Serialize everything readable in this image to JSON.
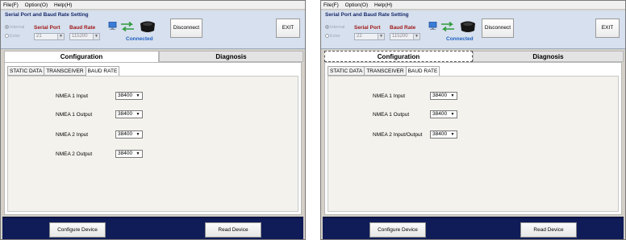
{
  "windows": [
    {
      "menu": [
        "File(F)",
        "Option(O)",
        "Help(H)"
      ],
      "port_title": "Serial Port and Baud Rate Setting",
      "radio_internal": "Internal",
      "radio_external": "Exter",
      "serial_port_label": "Serial Port",
      "baud_rate_label": "Baud Rate",
      "serial_port_value": "21",
      "baud_rate_value": "115200",
      "connected_text": "Connected",
      "disconnect_label": "Disconnect",
      "exit_label": "EXIT",
      "tab_configuration": "Configuration",
      "tab_diagnosis": "Diagnosis",
      "subtabs": [
        "STATIC DATA",
        "TRANSCEIVER",
        "BAUD RATE"
      ],
      "rows": [
        {
          "label": "NMEA 1 Input",
          "value": "38400"
        },
        {
          "label": "NMEA 1 Output",
          "value": "38400"
        },
        {
          "label": "NMEA 2 Input",
          "value": "38400"
        },
        {
          "label": "NMEA 2 Output",
          "value": "38400"
        }
      ],
      "configure_label": "Configure Device",
      "read_label": "Read Device"
    },
    {
      "menu": [
        "File(F)",
        "Option(O)",
        "Help(H)"
      ],
      "port_title": "Serial Port and Baud Rate Setting",
      "radio_internal": "Internal",
      "radio_external": "Exter",
      "serial_port_label": "Serial Port",
      "baud_rate_label": "Baud Rate",
      "serial_port_value": "22",
      "baud_rate_value": "115200",
      "connected_text": "Connected",
      "disconnect_label": "Disconnect",
      "exit_label": "EXIT",
      "tab_configuration": "Configuration",
      "tab_diagnosis": "Diagnosis",
      "subtabs": [
        "STATIC DATA",
        "TRANSCEIVER",
        "BAUD RATE"
      ],
      "rows": [
        {
          "label": "NMEA 1 Input",
          "value": "38400"
        },
        {
          "label": "NMEA 1 Output",
          "value": "38400"
        },
        {
          "label": "NMEA 2 Input/Output",
          "value": "38400"
        }
      ],
      "configure_label": "Configure Device",
      "read_label": "Read Device"
    }
  ]
}
